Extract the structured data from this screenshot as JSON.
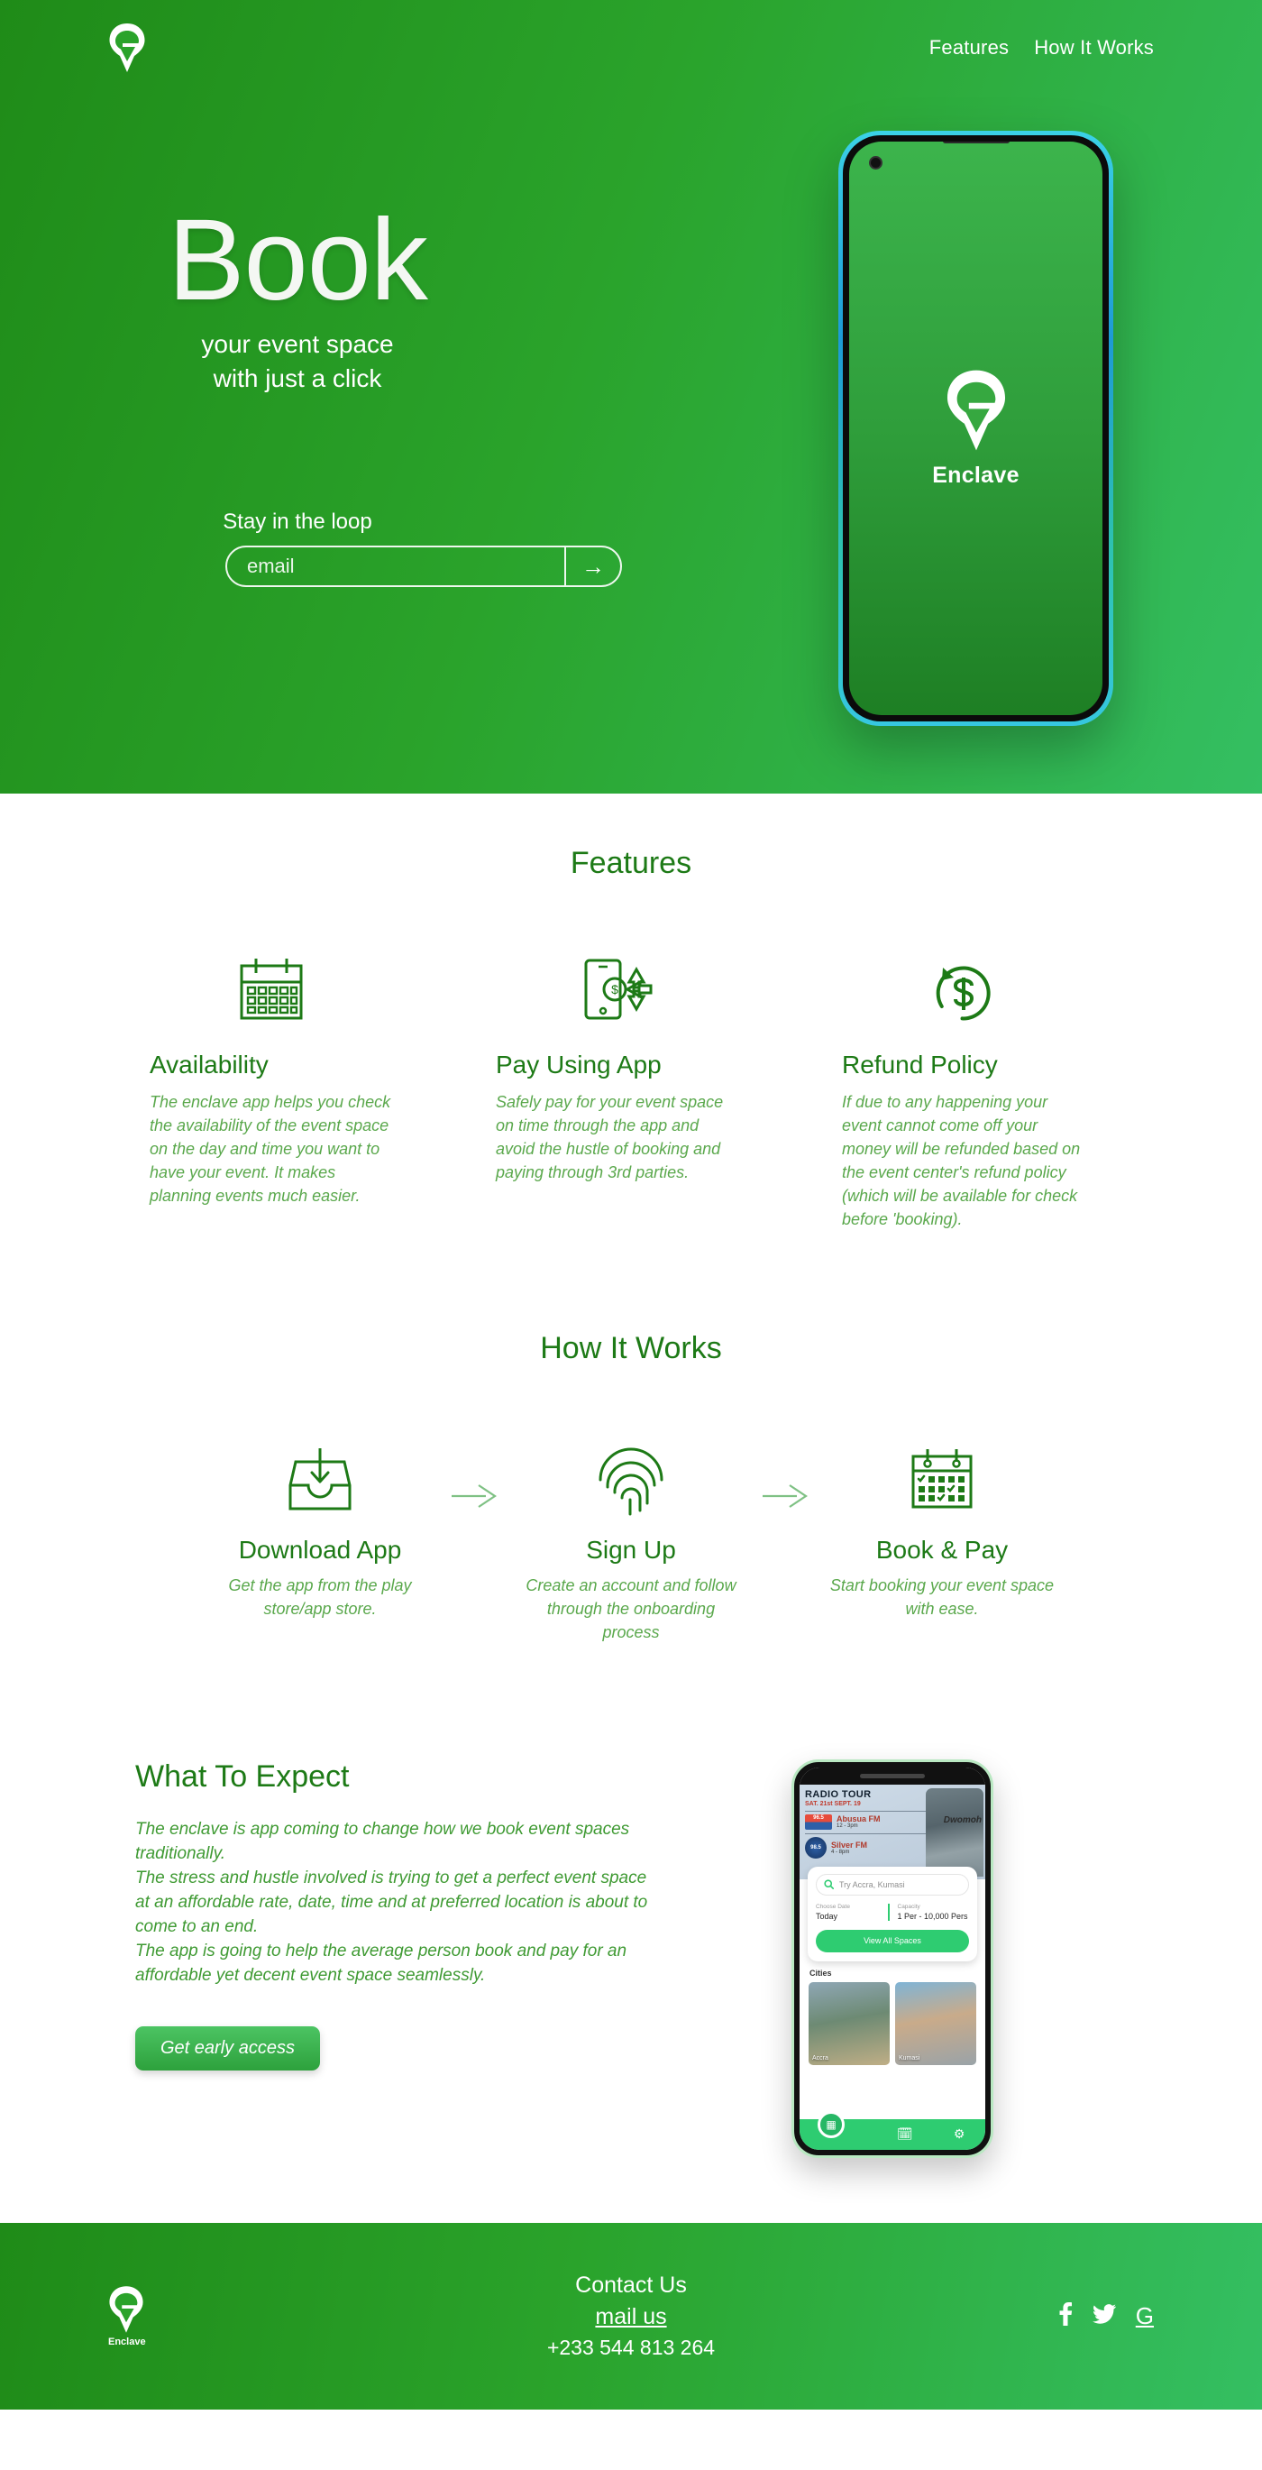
{
  "brand": {
    "name": "Enclave",
    "accent": "#1d7a16",
    "accent_light": "#5aa84c"
  },
  "nav": {
    "links": [
      {
        "label": "Features"
      },
      {
        "label": "How It Works"
      }
    ]
  },
  "hero": {
    "title": "Book",
    "subtitle_line1": "your event space",
    "subtitle_line2": "with just a click",
    "loop_label": "Stay in the loop",
    "email_placeholder": "email",
    "email_value": "",
    "submit_icon": "→",
    "phone_brand": "Enclave"
  },
  "features": {
    "heading": "Features",
    "items": [
      {
        "icon": "calendar-icon",
        "title": "Availability",
        "body": "The enclave app helps you check the availability of the event space on the day and time you want to have your event. It makes planning events much easier."
      },
      {
        "icon": "mobile-payment-icon",
        "title": "Pay Using App",
        "body": "Safely pay for your event space on time through the app and avoid the hustle of booking and paying through 3rd parties."
      },
      {
        "icon": "refund-dollar-icon",
        "title": "Refund Policy",
        "body": "If due to any happening your event cannot come off your money will be refunded based on the event center's refund policy (which will be available for check before 'booking)."
      }
    ]
  },
  "how_it_works": {
    "heading": "How It Works",
    "steps": [
      {
        "icon": "download-tray-icon",
        "title": "Download App",
        "body": "Get the app from the play store/app store."
      },
      {
        "icon": "fingerprint-icon",
        "title": "Sign Up",
        "body": "Create an account and follow through the onboarding process"
      },
      {
        "icon": "calendar-check-icon",
        "title": "Book & Pay",
        "body": "Start booking your event space with ease."
      }
    ]
  },
  "expect": {
    "heading": "What To Expect",
    "paragraphs": [
      "The enclave is app coming to change how we book event spaces traditionally.",
      "The stress and hustle involved is trying to get a perfect event space at an affordable rate, date, time and at preferred location is about to come to an end.",
      "The app is going to help the average person book and pay for an affordable yet decent event space seamlessly."
    ],
    "cta_label": "Get early access"
  },
  "app_preview": {
    "banner_title": "RADIO TOUR",
    "banner_date": "SAT. 21st SEPT. 19",
    "banner_script": "Dwomoh",
    "stations": [
      {
        "badge": "96.5",
        "name": "Abusua FM",
        "time": "12 - 3pm"
      },
      {
        "badge": "98.5",
        "name": "Silver FM",
        "time": "4 - 8pm"
      }
    ],
    "search_placeholder": "Try Accra, Kumasi",
    "date_label": "Choose Date",
    "date_value": "Today",
    "capacity_label": "Capacity",
    "capacity_value": "1 Per - 10,000 Pers",
    "view_all_label": "View All Spaces",
    "cities_label": "Cities",
    "cities": [
      {
        "name": "Accra"
      },
      {
        "name": "Kumasi"
      }
    ]
  },
  "footer": {
    "brand": "Enclave",
    "contact_heading": "Contact Us",
    "mail_label": "mail us",
    "phone": "+233 544 813 264",
    "socials": [
      {
        "icon": "facebook-icon",
        "glyph": "f"
      },
      {
        "icon": "twitter-icon",
        "glyph": "t"
      },
      {
        "icon": "google-icon",
        "glyph": "G"
      }
    ]
  }
}
